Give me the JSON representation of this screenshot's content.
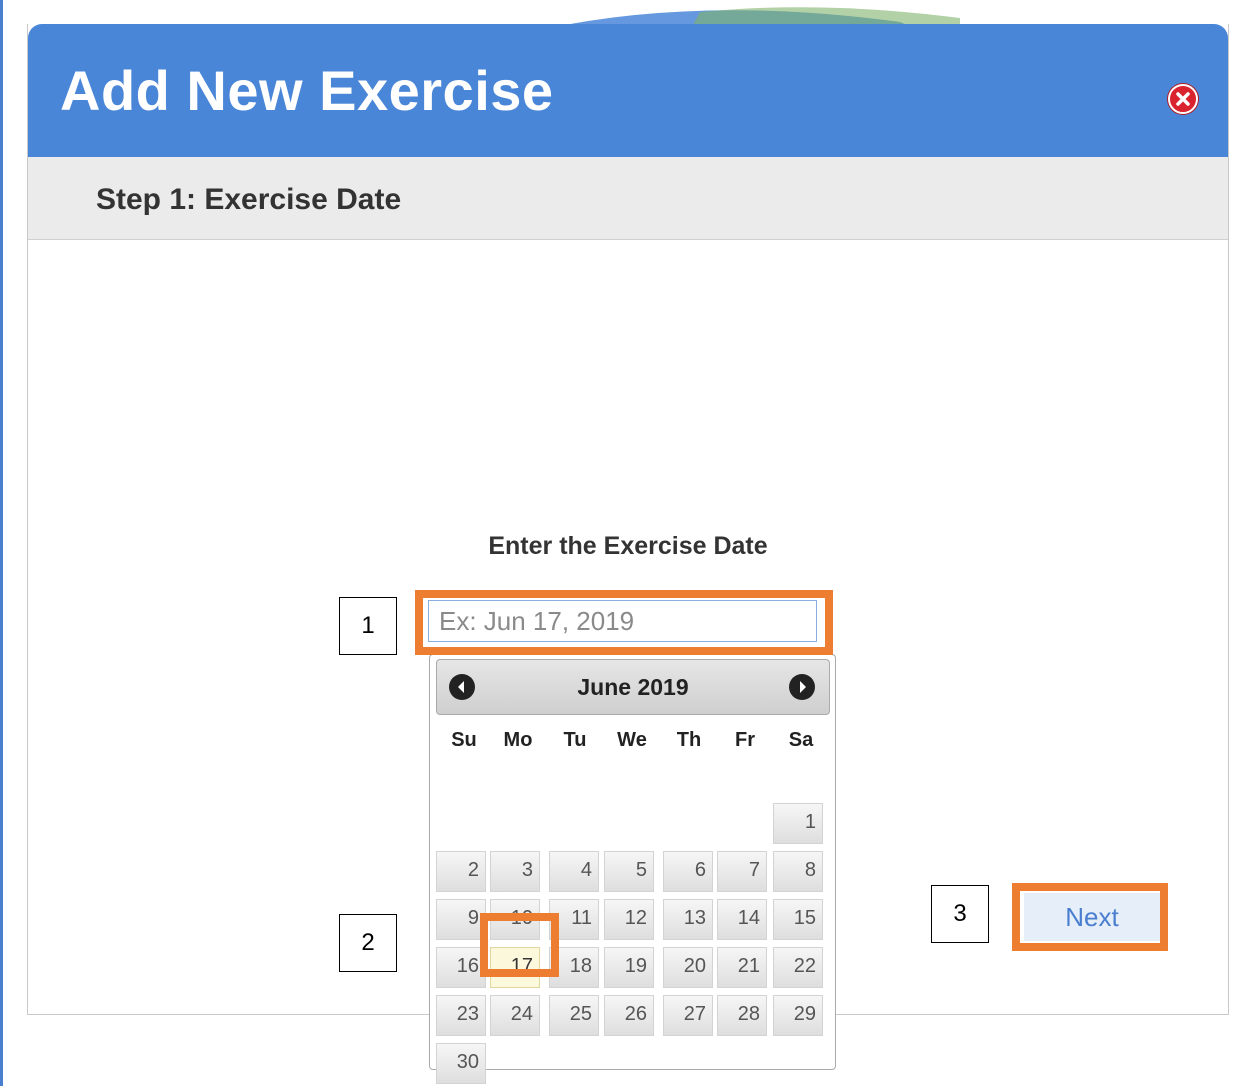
{
  "dialog": {
    "title": "Add New Exercise",
    "step_label": "Step 1: Exercise Date",
    "prompt": "Enter the Exercise Date"
  },
  "date_input": {
    "value": "",
    "placeholder": "Ex: Jun 17, 2019"
  },
  "datepicker": {
    "month_label": "June 2019",
    "weekdays": [
      "Su",
      "Mo",
      "Tu",
      "We",
      "Th",
      "Fr",
      "Sa"
    ],
    "weeks": [
      [
        "",
        "",
        "",
        "",
        "",
        "",
        "1"
      ],
      [
        "2",
        "3",
        "4",
        "5",
        "6",
        "7",
        "8"
      ],
      [
        "9",
        "10",
        "11",
        "12",
        "13",
        "14",
        "15"
      ],
      [
        "16",
        "17",
        "18",
        "19",
        "20",
        "21",
        "22"
      ],
      [
        "23",
        "24",
        "25",
        "26",
        "27",
        "28",
        "29"
      ],
      [
        "30",
        "",
        "",
        "",
        "",
        "",
        ""
      ]
    ],
    "today": "17"
  },
  "next_button": {
    "label": "Next"
  },
  "callouts": [
    "1",
    "2",
    "3"
  ],
  "colors": {
    "header_blue": "#4a86d8",
    "highlight_orange": "#ed7d31",
    "today_bg": "#fcf8dc",
    "close_red": "#d9232e"
  },
  "icons": {
    "close": "close-icon",
    "prev_month": "chevron-left-icon",
    "next_month": "chevron-right-icon"
  }
}
